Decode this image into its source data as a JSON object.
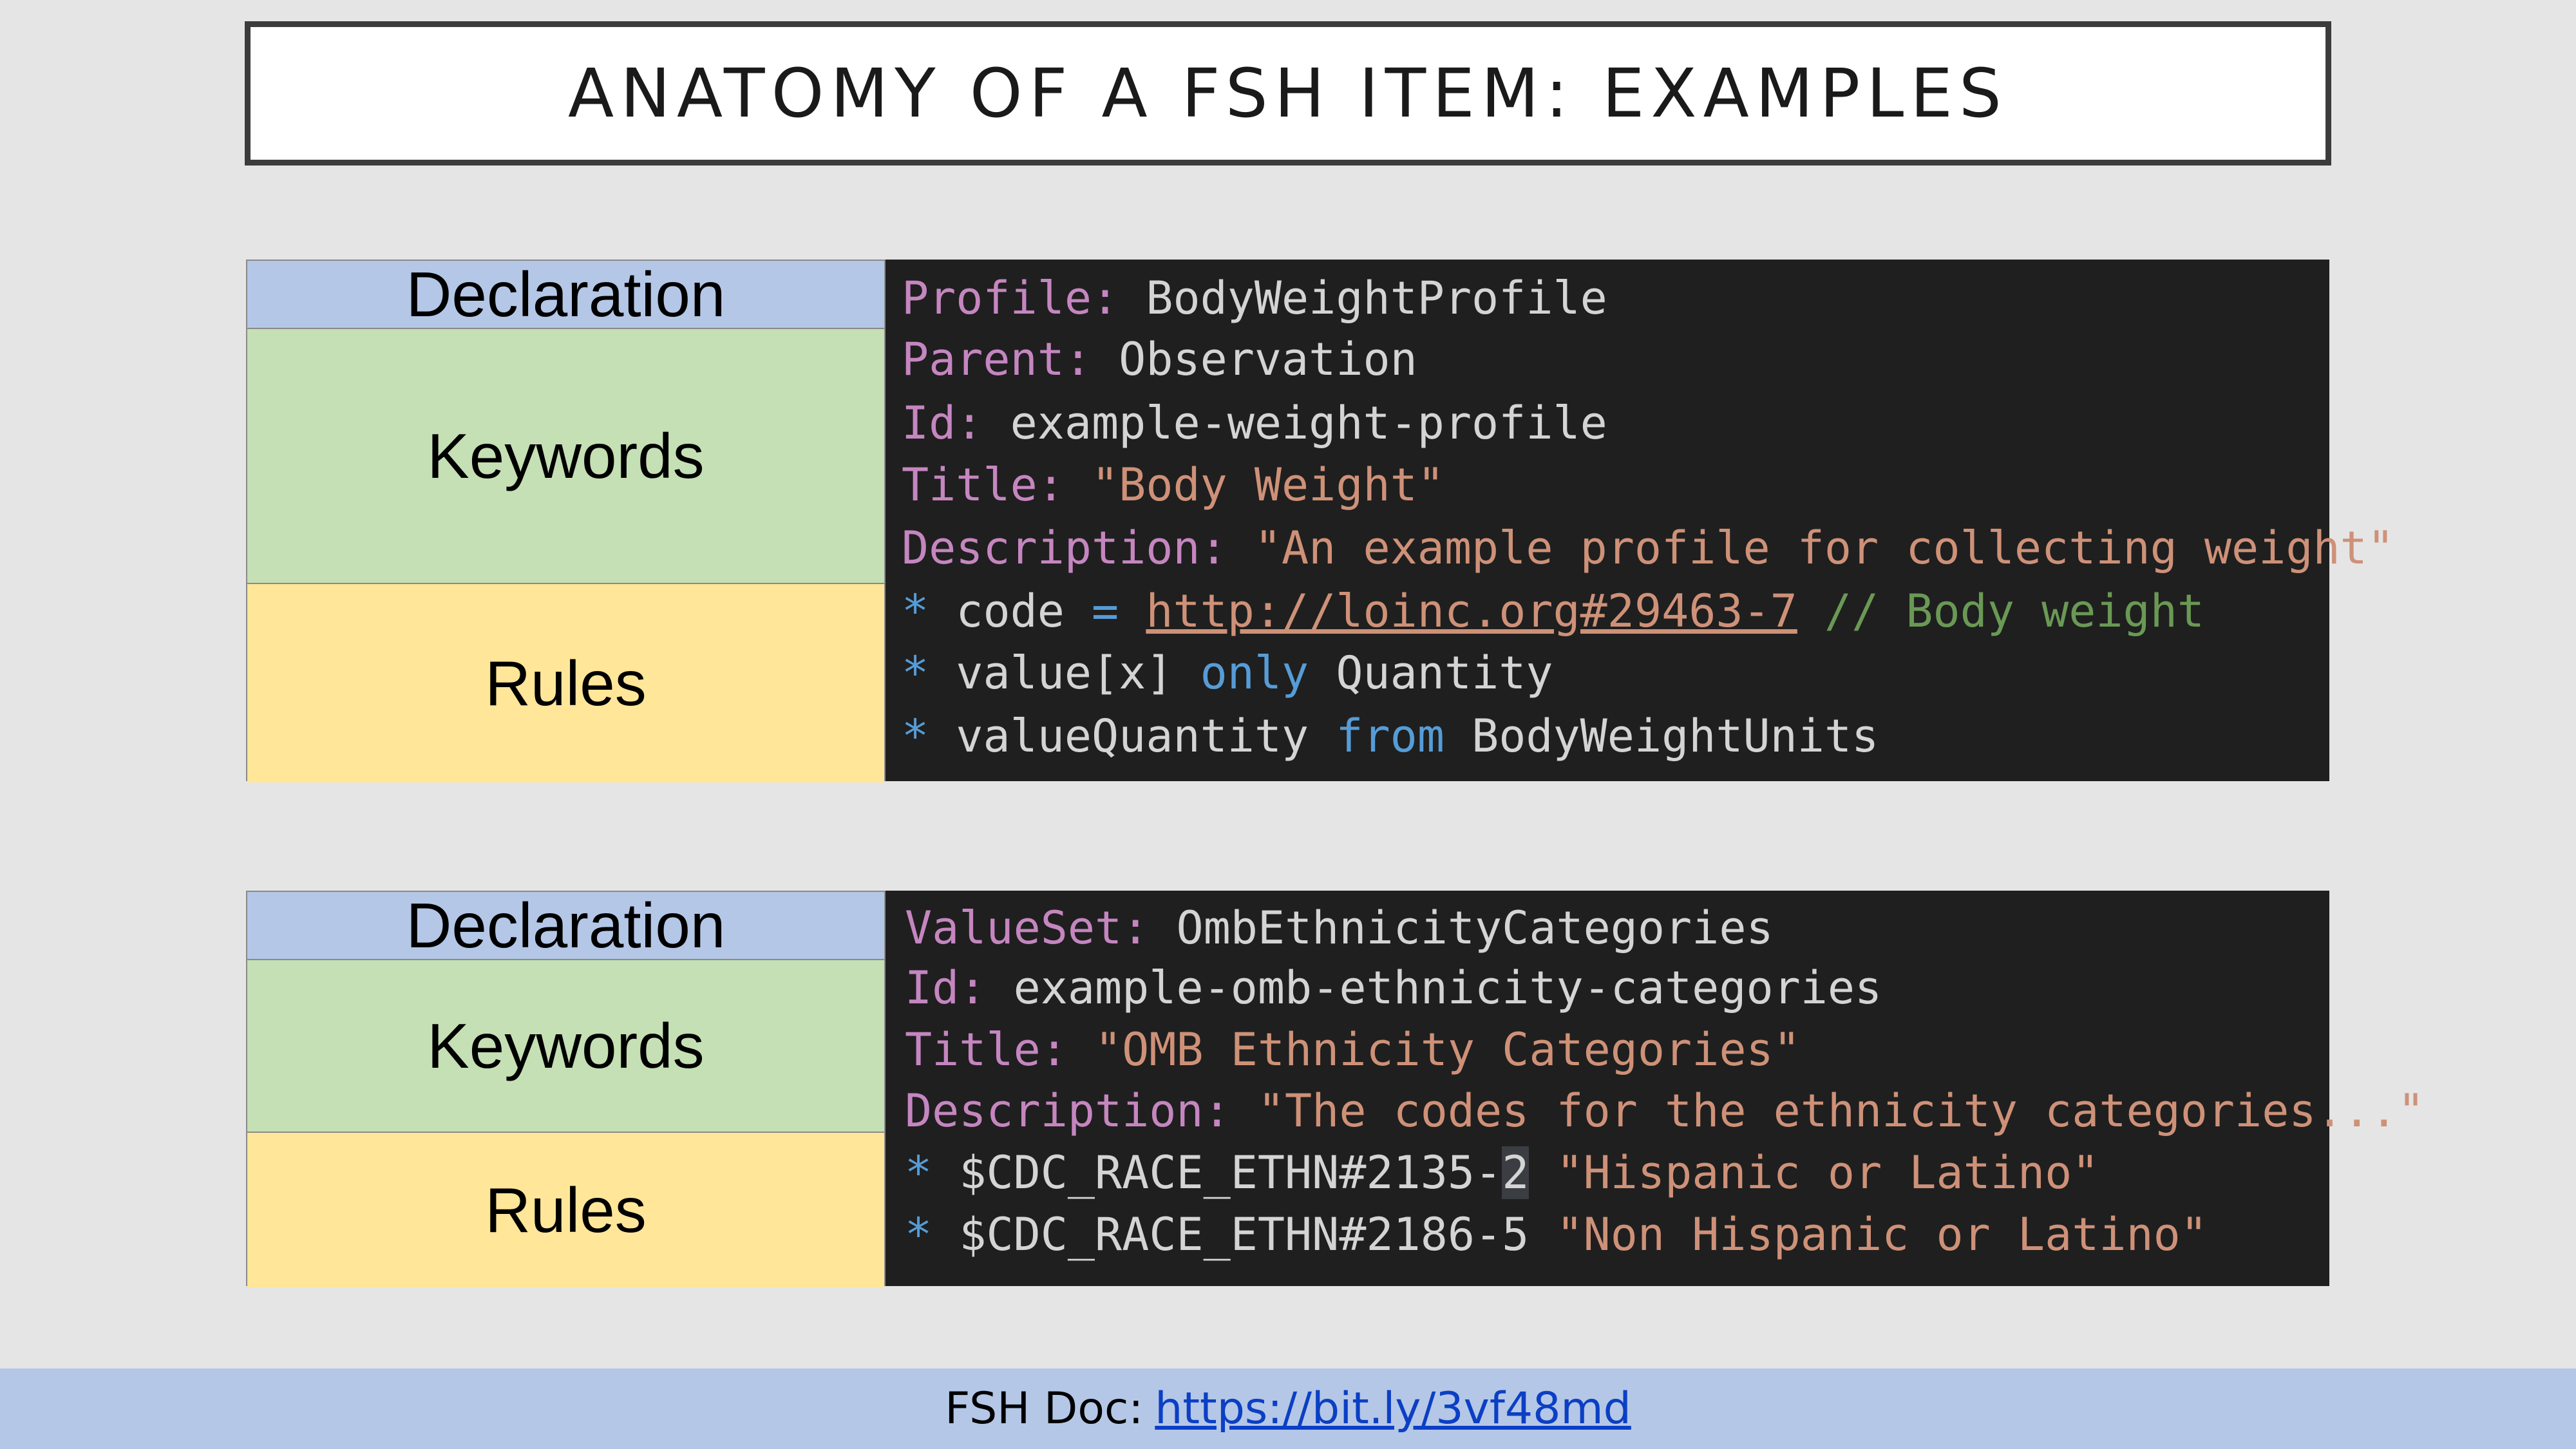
{
  "title": "ANATOMY OF A FSH ITEM: EXAMPLES",
  "labels": {
    "declaration": "Declaration",
    "keywords": "Keywords",
    "rules": "Rules"
  },
  "example1": {
    "profile_kw": "Profile:",
    "profile_val": "BodyWeightProfile",
    "parent_kw": "Parent:",
    "parent_val": "Observation",
    "id_kw": "Id:",
    "id_val": "example-weight-profile",
    "title_kw": "Title:",
    "title_val": "\"Body Weight\"",
    "desc_kw": "Description:",
    "desc_val": "\"An example profile for collecting weight\"",
    "rule1_star": "*",
    "rule1_path": "code",
    "rule1_op": "=",
    "rule1_link": "http://loinc.org#29463-7",
    "rule1_comment": "// Body weight",
    "rule2_star": "*",
    "rule2_path": "value[x]",
    "rule2_kw": "only",
    "rule2_type": "Quantity",
    "rule3_star": "*",
    "rule3_path": "valueQuantity",
    "rule3_kw": "from",
    "rule3_vs": "BodyWeightUnits"
  },
  "example2": {
    "valueset_kw": "ValueSet:",
    "valueset_val": "OmbEthnicityCategories",
    "id_kw": "Id:",
    "id_val": "example-omb-ethnicity-categories",
    "title_kw": "Title:",
    "title_val": "\"OMB Ethnicity Categories\"",
    "desc_kw": "Description:",
    "desc_val": "\"The codes for the ethnicity categories...\"",
    "rule1_star": "*",
    "rule1_system": "$CDC_RACE_ETHN#2135-",
    "rule1_code_last": "2",
    "rule1_display": "\"Hispanic or Latino\"",
    "rule2_star": "*",
    "rule2_system": "$CDC_RACE_ETHN#2186-5",
    "rule2_display": "\"Non Hispanic or Latino\""
  },
  "footer": {
    "label": "FSH Doc:",
    "link": "https://bit.ly/3vf48md"
  }
}
